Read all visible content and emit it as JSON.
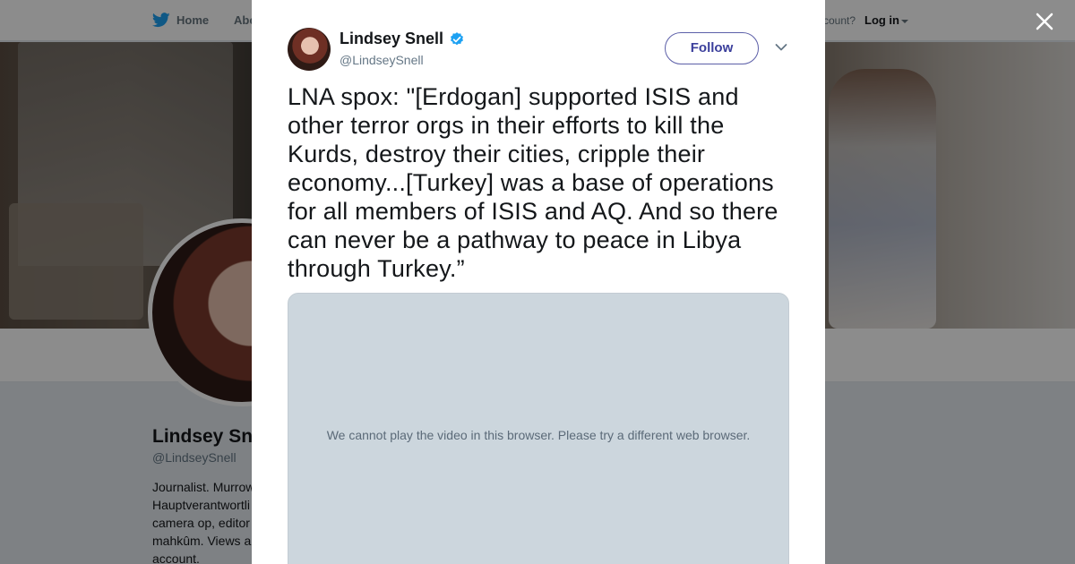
{
  "topnav": {
    "home_label": "Home",
    "about_label": "Abo",
    "account_prompt": "ccount?",
    "login_label": "Log in"
  },
  "profile": {
    "name": "Lindsey Sn",
    "handle": "@LindseySnell",
    "bio": "Journalist. Murrow Hauptverantwortli camera op, editor mahkûm. Views a account."
  },
  "tweet": {
    "author_name": "Lindsey Snell",
    "author_handle": "@LindseySnell",
    "follow_label": "Follow",
    "text": "LNA spox: \"[Erdogan] supported ISIS and other terror orgs in their efforts to kill the Kurds, destroy their cities, cripple their economy...[Turkey] was a base of operations for all members of ISIS and AQ. And so there can never be a pathway to peace in Libya through Turkey.”",
    "video_message": "We cannot play the video in this browser. Please try a different web browser."
  },
  "colors": {
    "twitter_blue": "#1da1f2",
    "follow_border": "#5c5fa8",
    "overlay": "rgba(0,0,0,0.45)",
    "video_bg": "#ccd6dd"
  },
  "icons": [
    "twitter-bird-icon",
    "caret-down-icon",
    "close-icon",
    "verified-badge-icon",
    "chevron-down-icon"
  ]
}
